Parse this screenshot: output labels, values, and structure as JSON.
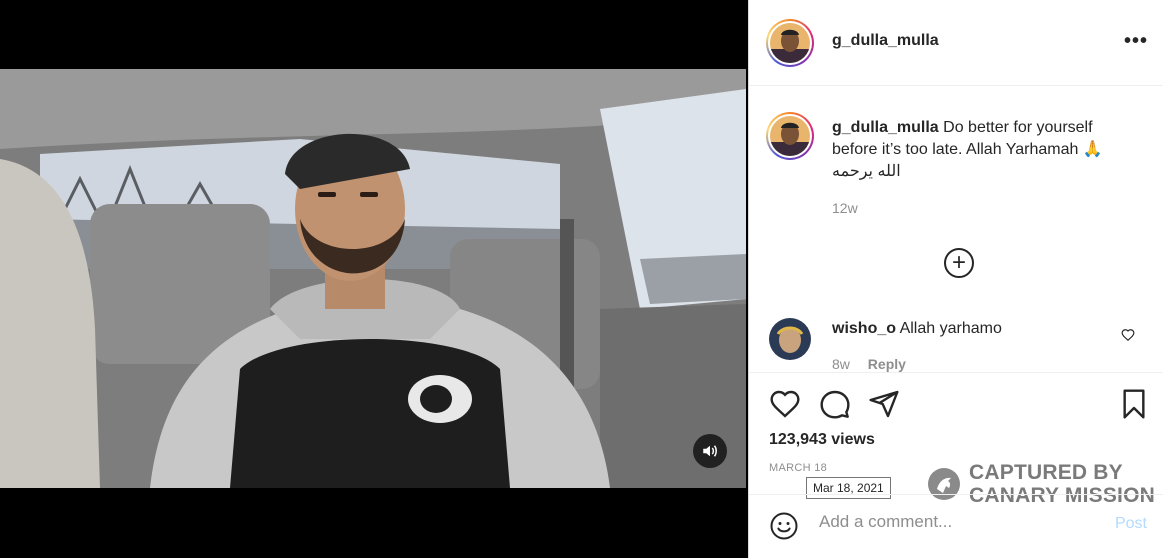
{
  "post": {
    "username": "g_dulla_mulla",
    "more_icon": "•••"
  },
  "caption": {
    "username": "g_dulla_mulla",
    "text_line1": " Do better for yourself",
    "text_line2": "before it’s too late. Allah Yarhamah 🙏",
    "text_line3": "الله يرحمه",
    "age": "12w"
  },
  "load_more_icon": "+",
  "comment": {
    "username": "wisho_o",
    "text": " Allah yarhamo",
    "age": "8w",
    "reply_label": "Reply"
  },
  "stats": {
    "views": "123,943 views",
    "date": "MARCH 18",
    "tooltip": "Mar 18, 2021"
  },
  "watermark": {
    "line1": "CAPTURED BY",
    "line2": "CANARY MISSION"
  },
  "composer": {
    "placeholder": "Add a comment...",
    "post_label": "Post"
  },
  "colors": {
    "accent_disabled": "#b3dbff",
    "secondary_text": "#8e8e8e",
    "primary_text": "#262626"
  },
  "icons": [
    "more-options-icon",
    "add-circle-icon",
    "heart-icon",
    "comment-icon",
    "share-icon",
    "bookmark-icon",
    "emoji-icon",
    "volume-icon"
  ]
}
